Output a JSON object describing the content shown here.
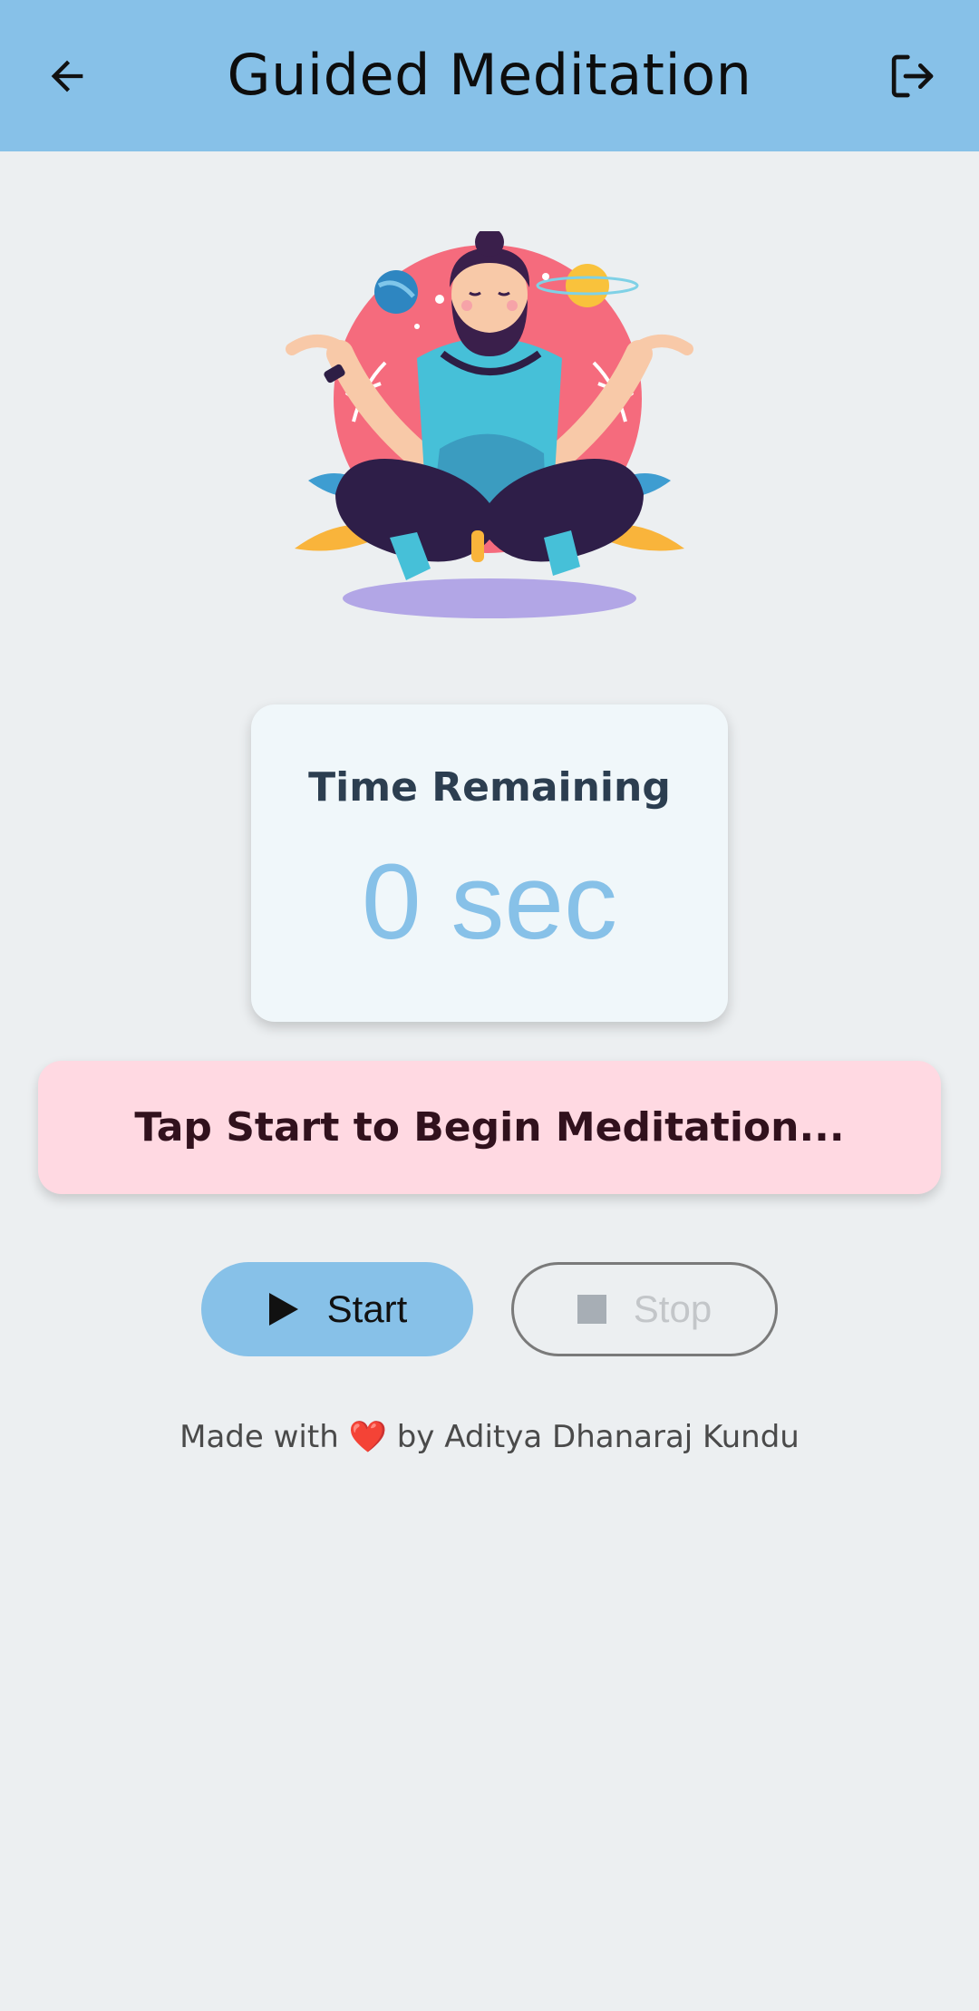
{
  "appbar": {
    "title": "Guided Meditation",
    "back_icon": "arrow-left-icon",
    "logout_icon": "logout-icon",
    "background_color": "#87C1E8"
  },
  "illustration": {
    "icon": "meditating-man-illustration"
  },
  "timer": {
    "label": "Time Remaining",
    "value": "0 sec",
    "value_color": "#87C1E8"
  },
  "status": {
    "message": "Tap Start to Begin Meditation...",
    "background_color": "#FFD9E2"
  },
  "controls": {
    "start_label": "Start",
    "start_icon": "play-icon",
    "stop_label": "Stop",
    "stop_icon": "stop-icon",
    "stop_enabled": false
  },
  "footer": {
    "prefix": "Made with",
    "heart": "❤️",
    "suffix": "by Aditya Dhanaraj Kundu"
  }
}
